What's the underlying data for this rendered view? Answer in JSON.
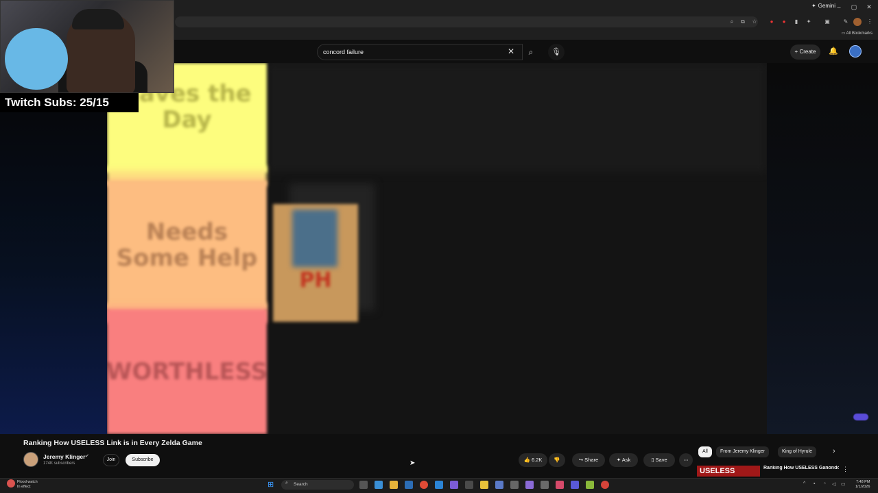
{
  "browser": {
    "gemini_label": "Gemini",
    "all_bookmarks": "All Bookmarks",
    "window_controls": [
      "minimize-icon",
      "maximize-icon",
      "close-icon"
    ]
  },
  "youtube": {
    "search_query": "concord failure",
    "create_label": "Create"
  },
  "overlay": {
    "subs_label": "Twitch Subs: 25/15"
  },
  "video_frame": {
    "tiers": [
      "Saves the Day",
      "Needs Some Help",
      "WORTHLESS"
    ],
    "card_text": "PH"
  },
  "video": {
    "title": "Ranking How USELESS Link is in Every Zelda Game",
    "channel": "Jeremy Klinger",
    "subscribers": "174K subscribers",
    "join_label": "Join",
    "subscribe_label": "Subscribe",
    "likes": "6.2K",
    "share_label": "Share",
    "ask_label": "Ask",
    "save_label": "Save"
  },
  "recommendations": {
    "chips": [
      "All",
      "From Jeremy Klinger",
      "King of Hyrule"
    ],
    "first": {
      "thumb_text": "USELESS",
      "title": "Ranking How USELESS Ganondorf is in Every Zelda"
    }
  },
  "taskbar": {
    "weather_line1": "Flood watch",
    "weather_line2": "In effect",
    "search_placeholder": "Search",
    "time": "7:48 PM",
    "date": "1/1/2026"
  }
}
